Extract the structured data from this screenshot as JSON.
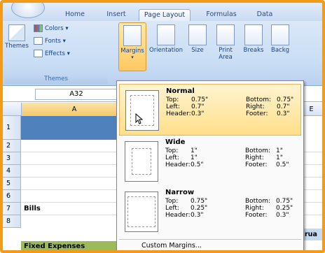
{
  "tabs": [
    {
      "label": "Home"
    },
    {
      "label": "Insert"
    },
    {
      "label": "Page Layout"
    },
    {
      "label": "Formulas"
    },
    {
      "label": "Data"
    }
  ],
  "ribbon": {
    "themes_label": "Themes",
    "themes_btn": "Themes",
    "colors_label": "Colors",
    "fonts_label": "Fonts",
    "effects_label": "Effects",
    "margins_label": "Margins",
    "orientation_label": "Orientation",
    "size_label": "Size",
    "print_area_label": "Print Area",
    "breaks_label": "Breaks",
    "background_label": "Backg"
  },
  "formula_bar": {
    "name_box": "A32"
  },
  "columns": {
    "a": "A",
    "e": "E"
  },
  "rows": [
    "1",
    "2",
    "3",
    "4",
    "5",
    "6",
    "7",
    "8"
  ],
  "cells": {
    "row7": "Bills",
    "row8": "Fixed Expenses",
    "row7_right": "rua"
  },
  "margins_menu": {
    "options": [
      {
        "name": "Normal",
        "top_k": "Top:",
        "top_v": "0.75\"",
        "bottom_k": "Bottom:",
        "bottom_v": "0.75\"",
        "left_k": "Left:",
        "left_v": "0.7\"",
        "right_k": "Right:",
        "right_v": "0.7\"",
        "header_k": "Header:",
        "header_v": "0.3\"",
        "footer_k": "Footer:",
        "footer_v": "0.3\""
      },
      {
        "name": "Wide",
        "top_k": "Top:",
        "top_v": "1\"",
        "bottom_k": "Bottom:",
        "bottom_v": "1\"",
        "left_k": "Left:",
        "left_v": "1\"",
        "right_k": "Right:",
        "right_v": "1\"",
        "header_k": "Header:",
        "header_v": "0.5\"",
        "footer_k": "Footer:",
        "footer_v": "0.5\""
      },
      {
        "name": "Narrow",
        "top_k": "Top:",
        "top_v": "0.75\"",
        "bottom_k": "Bottom:",
        "bottom_v": "0.75\"",
        "left_k": "Left:",
        "left_v": "0.25\"",
        "right_k": "Right:",
        "right_v": "0.25\"",
        "header_k": "Header:",
        "header_v": "0.3\"",
        "footer_k": "Footer:",
        "footer_v": "0.3\""
      }
    ],
    "custom": "Custom Margins..."
  },
  "colors": {
    "accent": "#f29a1a",
    "selected_cell": "#4f81bd",
    "expense_cell": "#9bbb59"
  }
}
